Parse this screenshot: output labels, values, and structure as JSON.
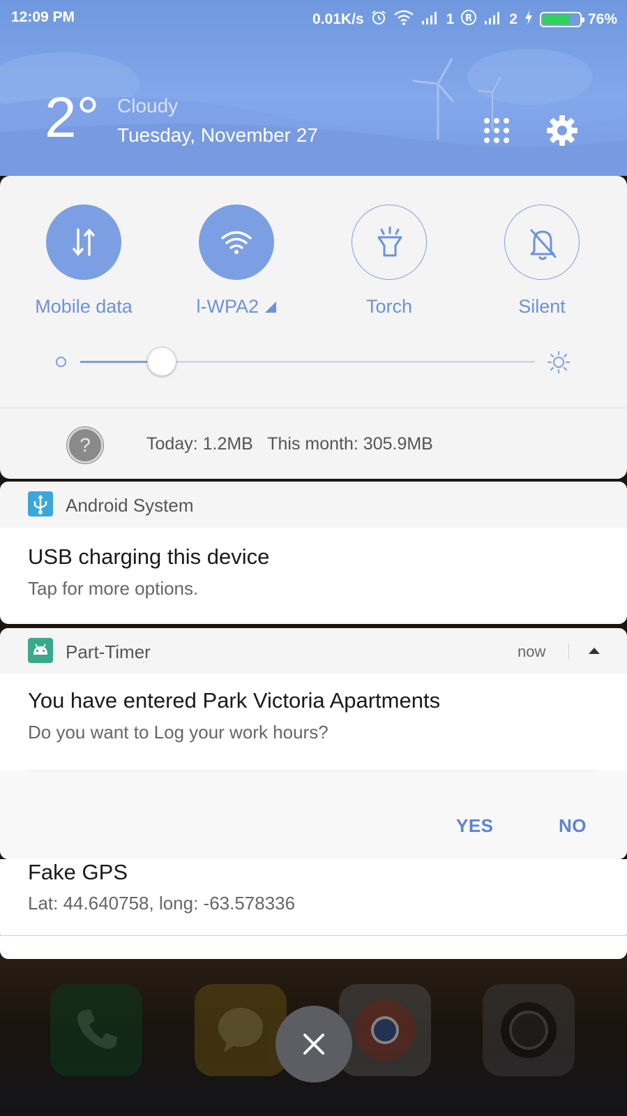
{
  "status_bar": {
    "time": "12:09 PM",
    "speed": "0.01K/s",
    "sim1": "1",
    "sim2": "2",
    "battery": "76%",
    "battery_level": 0.76,
    "icons": [
      "alarm-icon",
      "wifi-icon",
      "signal-icon",
      "roaming-icon",
      "signal-icon",
      "charging-icon",
      "battery-icon"
    ]
  },
  "weather": {
    "temperature": "2°",
    "condition": "Cloudy",
    "date": "Tuesday, November 27"
  },
  "header_icons": [
    "apps-grid-icon",
    "settings-gear-icon"
  ],
  "quick_settings": {
    "tiles": [
      {
        "label": "Mobile data",
        "icon": "mobile-data-icon",
        "active": true
      },
      {
        "label": "l-WPA2",
        "icon": "wifi-icon",
        "active": true
      },
      {
        "label": "Torch",
        "icon": "torch-icon",
        "active": false
      },
      {
        "label": "Silent",
        "icon": "silent-bell-icon",
        "active": false
      }
    ],
    "brightness_level": 0.18,
    "usage_icon": "?",
    "usage_text": "Today: 1.2MB   This month: 305.9MB"
  },
  "notifications": [
    {
      "app": "Android System",
      "icon": "usb-icon",
      "title": "USB charging this device",
      "text": "Tap for more options."
    },
    {
      "app": "Part-Timer",
      "icon": "android-icon",
      "time": "now",
      "title": "You have entered Park Victoria Apartments",
      "text": "Do you want to Log your work hours?",
      "actions": [
        "YES",
        "NO"
      ]
    },
    {
      "title": "Fake GPS",
      "text": "Lat: 44.640758, long: -63.578336"
    }
  ],
  "colors": {
    "accent": "#7b9fe2",
    "header_bg": "#7d9fe4",
    "panel_bg": "#f4f4f4"
  }
}
